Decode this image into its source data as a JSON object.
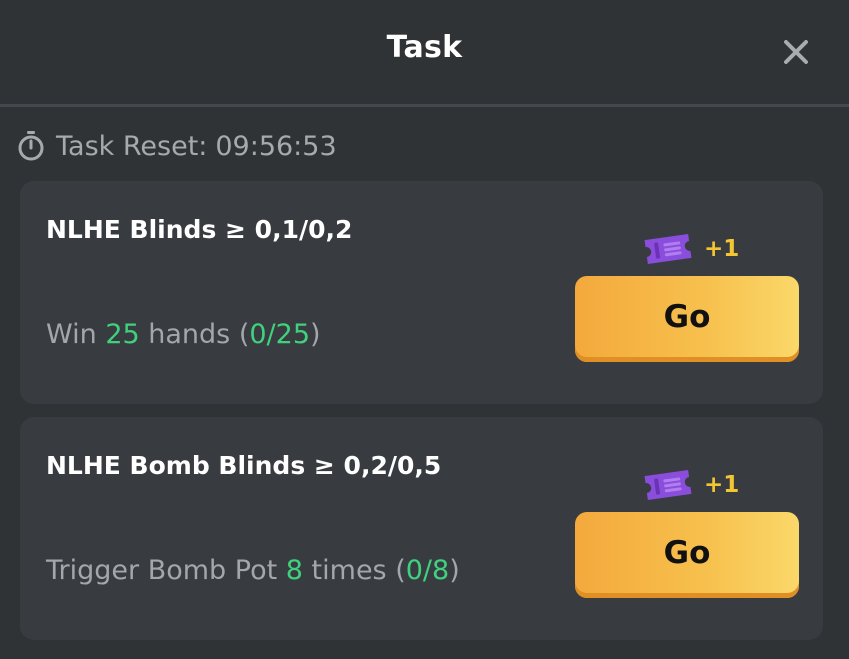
{
  "header": {
    "title": "Task",
    "close_icon": "close-icon"
  },
  "reset": {
    "icon": "timer-icon",
    "label": "Task Reset:",
    "time": "09:56:53"
  },
  "tasks": [
    {
      "title": "NLHE Blinds ≥ 0,1/0,2",
      "desc_prefix": "Win ",
      "desc_count": "25",
      "desc_middle": " hands (",
      "desc_progress": "0/25",
      "desc_suffix": ")",
      "reward_icon": "ticket-icon",
      "reward_amount": "+1",
      "button_label": "Go"
    },
    {
      "title": "NLHE Bomb Blinds ≥ 0,2/0,5",
      "desc_prefix": "Trigger Bomb Pot ",
      "desc_count": "8",
      "desc_middle": " times (",
      "desc_progress": "0/8",
      "desc_suffix": ")",
      "reward_icon": "ticket-icon",
      "reward_amount": "+1",
      "button_label": "Go"
    }
  ],
  "colors": {
    "background": "#303336",
    "card": "#383c40",
    "highlight_green": "#3fd17e",
    "reward_gold": "#f2c531",
    "ticket_purple": "#8b4ddb",
    "button_orange": "#f7c14e"
  }
}
